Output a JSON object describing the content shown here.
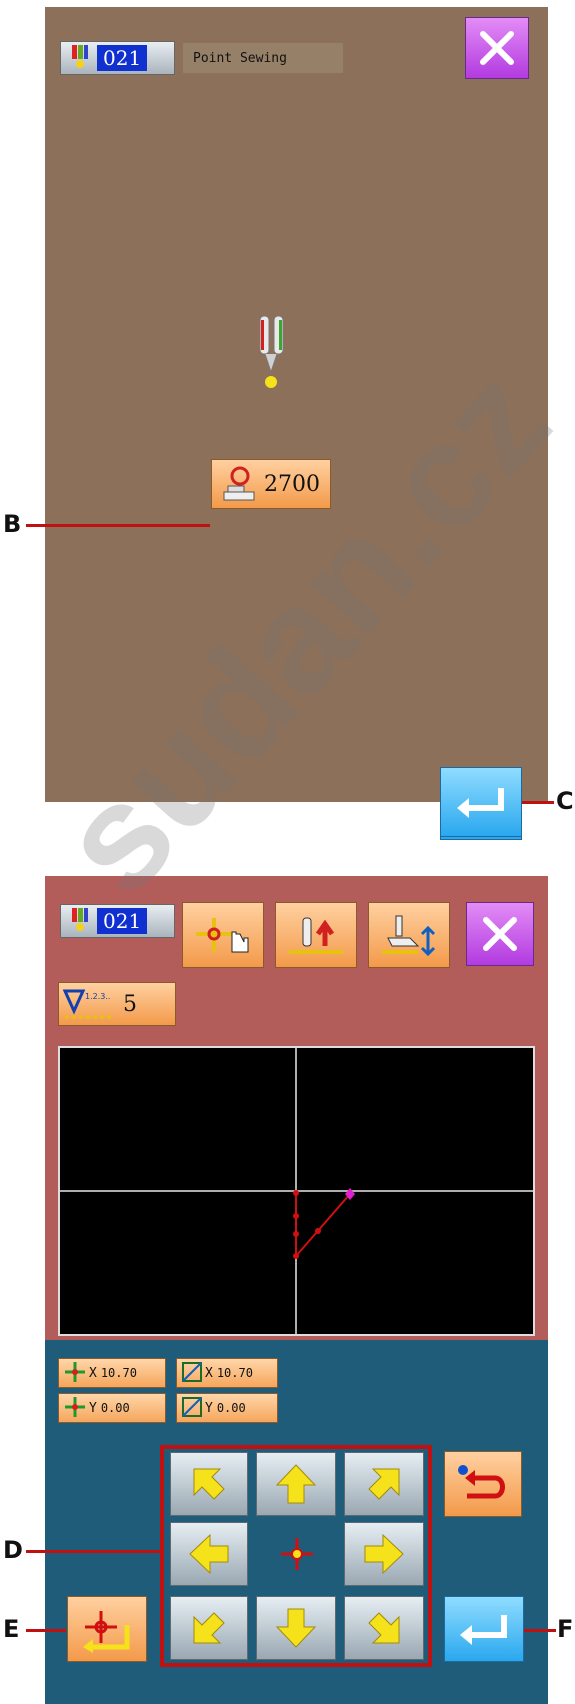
{
  "screen1": {
    "pattern_number": "021",
    "title": "Point Sewing",
    "speed_value": "2700"
  },
  "screen2": {
    "pattern_number": "021",
    "stitch_count": "5",
    "coords": {
      "x1": "10.70",
      "y1": "0.00",
      "x2": "10.70",
      "y2": "0.00",
      "x_label": "X",
      "y_label": "Y"
    }
  },
  "annotations": {
    "B": "B",
    "C": "C",
    "D": "D",
    "E": "E",
    "F": "F"
  },
  "watermark": "sudan.cz",
  "icons": {
    "close": "close-icon",
    "enter": "enter-icon",
    "return": "return-icon",
    "needle_thread": "needle-thread-icon"
  },
  "colors": {
    "screen1_bg": "#8d7059",
    "screen2_top_bg": "#b35d5a",
    "screen2_bottom_bg": "#1f5c7a",
    "canvas_bg": "#000000"
  }
}
